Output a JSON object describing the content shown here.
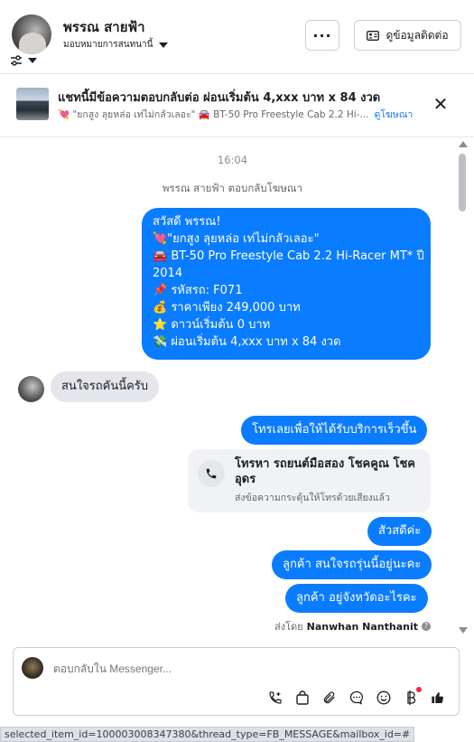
{
  "header": {
    "name": "พรรณ สายฟ้า",
    "assign_label": "มอบหมายการสนทนานี้",
    "more_label": "···",
    "contact_label": "ดูข้อมูลติดต่อ"
  },
  "ad": {
    "title": "แชทนี้มีข้อความตอบกลับต่อ ผ่อนเริ่มต้น 4,xxx บาท x 84 งวด",
    "subtitle": "💘 \"ยกสูง ลุยหล่อ เท่ไม่กลัวเลอะ\" 🚘 BT-50 Pro Freestyle Cab 2.2 Hi-...",
    "link": "ดูโฆษณา"
  },
  "thread": {
    "time": "16:04",
    "reply_note": "พรรณ สายฟ้า ตอบกลับโฆษณา",
    "ad_message_lines": [
      "สวัสดี พรรณ!",
      "💘\"ยกสูง ลุยหล่อ เท่ไม่กลัวเลอะ\"",
      "🚘 BT-50 Pro Freestyle Cab 2.2 Hi-Racer MT* ปี",
      "2014",
      "📌 รหัสรถ: F071",
      "💰 ราคาเพียง 249,000 บาท",
      "⭐ ดาวน์เริ่มต้น 0 บาท",
      "💸 ผ่อนเริ่มต้น 4,xxx บาท x 84 งวด"
    ],
    "customer_message": "สนใจรถคันนี้ครับ",
    "call_prompt": "โทรเลยเพื่อให้ได้รับบริการเร็วขึ้น",
    "call_card": {
      "title": "โทรหา รถยนต์มือสอง โชคคูณ โชค อุดร",
      "subtitle": "ส่งข้อความกระตุ้นให้โทรด้วยเสียงแล้ว"
    },
    "reply_1": "สัวสดีค่ะ",
    "reply_2": "ลูกค้า สนใจรถรุ่นนี้อยู่นะคะ",
    "reply_3": "ลูกค้า อยู่จังหวัดอะไรคะ",
    "sent_by_prefix": "ส่งโดย",
    "sent_by_name": "Nanwhan Nanthanit"
  },
  "composer": {
    "placeholder": "ตอบกลับใน Messenger..."
  },
  "status_url": "selected_item_id=100003008347380&thread_type=FB_MESSAGE&mailbox_id=#",
  "colors": {
    "accent": "#0a7cff",
    "link": "#1877f2",
    "badge": "#f02849"
  }
}
